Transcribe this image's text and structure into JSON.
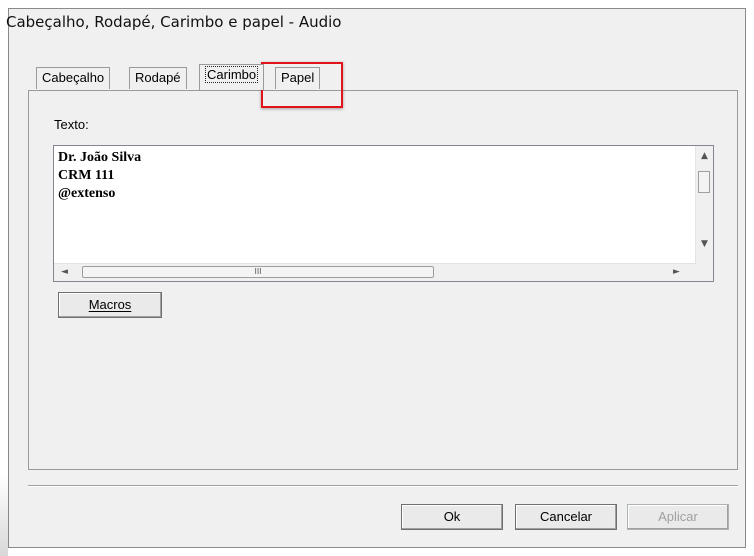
{
  "window": {
    "title": "Cabeçalho, Rodapé, Carimbo e papel - Audio"
  },
  "tabs": [
    {
      "label": "Cabeçalho",
      "active": false
    },
    {
      "label": "Rodapé",
      "active": false
    },
    {
      "label": "Carimbo",
      "active": true
    },
    {
      "label": "Papel",
      "active": false,
      "highlighted": true
    }
  ],
  "texto": {
    "label": "Texto:",
    "lines": [
      "Dr. João Silva",
      "CRM 111",
      "@extenso"
    ]
  },
  "buttons": {
    "macros": "Macros",
    "ok": "Ok",
    "cancelar": "Cancelar",
    "aplicar": "Aplicar"
  },
  "scrollbar": {
    "up_glyph": "▲",
    "down_glyph": "▼",
    "left_glyph": "◄",
    "right_glyph": "►",
    "thumb_grip": "III"
  },
  "colors": {
    "highlight": "#e2141b",
    "dialog_bg": "#f0f0f0"
  }
}
